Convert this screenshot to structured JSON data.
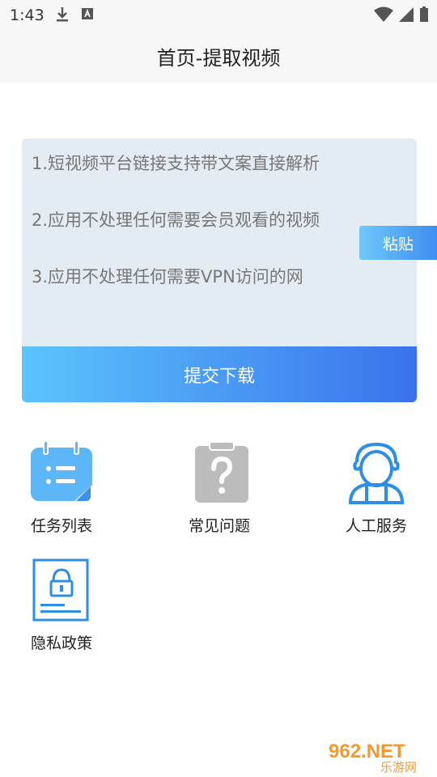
{
  "status_bar": {
    "time": "1:43",
    "icons_left": [
      "download-icon",
      "a-icon"
    ],
    "icons_right": [
      "wifi-icon",
      "signal-icon",
      "battery-icon"
    ]
  },
  "header": {
    "title": "首页-提取视频"
  },
  "input_area": {
    "text": "1.短视频平台链接支持带文案直接解析\n\n2.应用不处理任何需要会员观看的视频\n\n3.应用不处理任何需要VPN访问的网",
    "paste_label": "粘贴",
    "submit_label": "提交下载"
  },
  "menu": [
    {
      "label": "任务列表",
      "icon": "calendar-list-icon"
    },
    {
      "label": "常见问题",
      "icon": "question-clipboard-icon"
    },
    {
      "label": "人工服务",
      "icon": "customer-service-icon"
    },
    {
      "label": "隐私政策",
      "icon": "lock-document-icon"
    }
  ],
  "watermark": {
    "text_top": "962.NET",
    "text_bottom": "乐游网"
  },
  "colors": {
    "accent_start": "#5bc4fb",
    "accent_end": "#3a72ec",
    "card_bg": "#e3ebf3"
  }
}
